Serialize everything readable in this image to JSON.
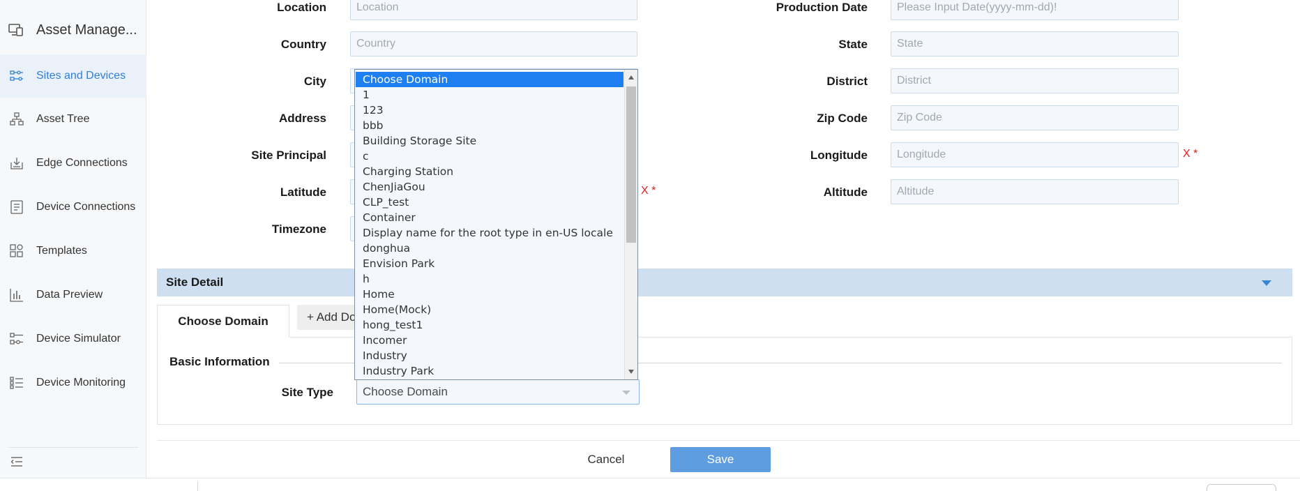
{
  "app": {
    "title": "Asset Manage..."
  },
  "sidebar": {
    "items": [
      {
        "label": "Sites and Devices",
        "icon": "sites-devices-icon",
        "active": true
      },
      {
        "label": "Asset Tree",
        "icon": "asset-tree-icon"
      },
      {
        "label": "Edge Connections",
        "icon": "edge-connections-icon"
      },
      {
        "label": "Device Connections",
        "icon": "device-connections-icon"
      },
      {
        "label": "Templates",
        "icon": "templates-icon"
      },
      {
        "label": "Data Preview",
        "icon": "data-preview-icon"
      },
      {
        "label": "Device Simulator",
        "icon": "device-simulator-icon"
      },
      {
        "label": "Device Monitoring",
        "icon": "device-monitoring-icon"
      }
    ],
    "collapse_icon": "collapse-menu-icon"
  },
  "form": {
    "location": {
      "label": "Location",
      "placeholder": "Location"
    },
    "country": {
      "label": "Country",
      "placeholder": "Country"
    },
    "city": {
      "label": "City"
    },
    "address": {
      "label": "Address"
    },
    "site_principal": {
      "label": "Site Principal"
    },
    "latitude": {
      "label": "Latitude",
      "required_mark": "X *"
    },
    "timezone": {
      "label": "Timezone"
    },
    "production_date": {
      "label": "Production Date",
      "placeholder": "Please Input Date(yyyy-mm-dd)!"
    },
    "state": {
      "label": "State",
      "placeholder": "State"
    },
    "district": {
      "label": "District",
      "placeholder": "District"
    },
    "zip_code": {
      "label": "Zip Code",
      "placeholder": "Zip Code"
    },
    "longitude": {
      "label": "Longitude",
      "placeholder": "Longitude",
      "required_mark": "X *"
    },
    "altitude": {
      "label": "Altitude",
      "placeholder": "Altitude"
    }
  },
  "site_detail": {
    "title": "Site Detail",
    "tabs": {
      "active": "Choose Domain",
      "add": "+ Add Do"
    },
    "section_title": "Basic Information",
    "site_type": {
      "label": "Site Type",
      "value": "Choose Domain"
    }
  },
  "dropdown": {
    "options": [
      "Choose Domain",
      "1",
      "123",
      "bbb",
      "Building Storage Site",
      "c",
      "Charging Station",
      "ChenJiaGou",
      "CLP_test",
      "Container",
      "Display name for the root type in en-US locale",
      "donghua",
      "Envision Park",
      "h",
      "Home",
      "Home(Mock)",
      "hong_test1",
      "Incomer",
      "Industry",
      "Industry Park"
    ],
    "selected_index": 0,
    "selected_color": "#1e80f0"
  },
  "actions": {
    "cancel": "Cancel",
    "save": "Save"
  },
  "colors": {
    "accent": "#2f7fd8",
    "save_button": "#5d9de0",
    "detail_bar": "#cddff0",
    "required": "#e02020"
  }
}
